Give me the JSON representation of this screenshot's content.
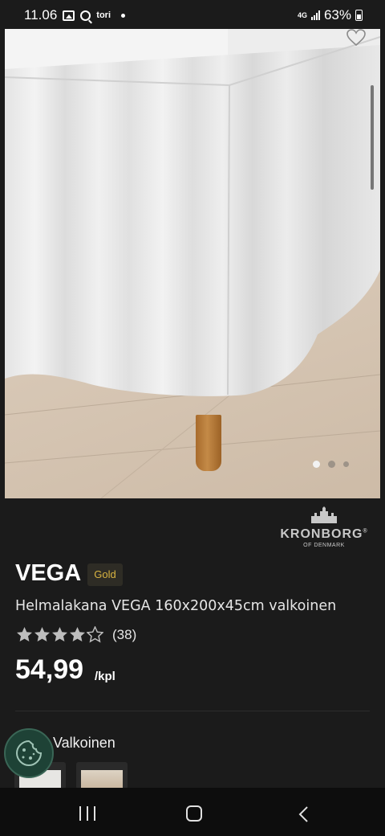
{
  "status_bar": {
    "time": "11.06",
    "app_label": "tori",
    "network": "4G",
    "battery": "63%"
  },
  "gallery": {
    "image_count": 3,
    "active_index": 0
  },
  "brand": {
    "name": "KRONBORG",
    "registered": "®",
    "subtitle": "OF DENMARK"
  },
  "product": {
    "title": "VEGA",
    "badge": "Gold",
    "description": "Helmalakana VEGA 160x200x45cm valkoinen",
    "rating": 4,
    "rating_max": 5,
    "review_count": "(38)",
    "price": "54,99",
    "price_unit": "/kpl"
  },
  "variant": {
    "color_label": "Valkoinen"
  },
  "colors": {
    "badge_text": "#d9b441",
    "background": "#1b1b1b",
    "cookie_button": "#1e4236",
    "star": "#bdbdbd"
  },
  "icons": {
    "favorite": "heart-icon",
    "cookie": "cookie-icon",
    "nav_recent": "recent-apps-icon",
    "nav_home": "home-icon",
    "nav_back": "back-icon"
  }
}
